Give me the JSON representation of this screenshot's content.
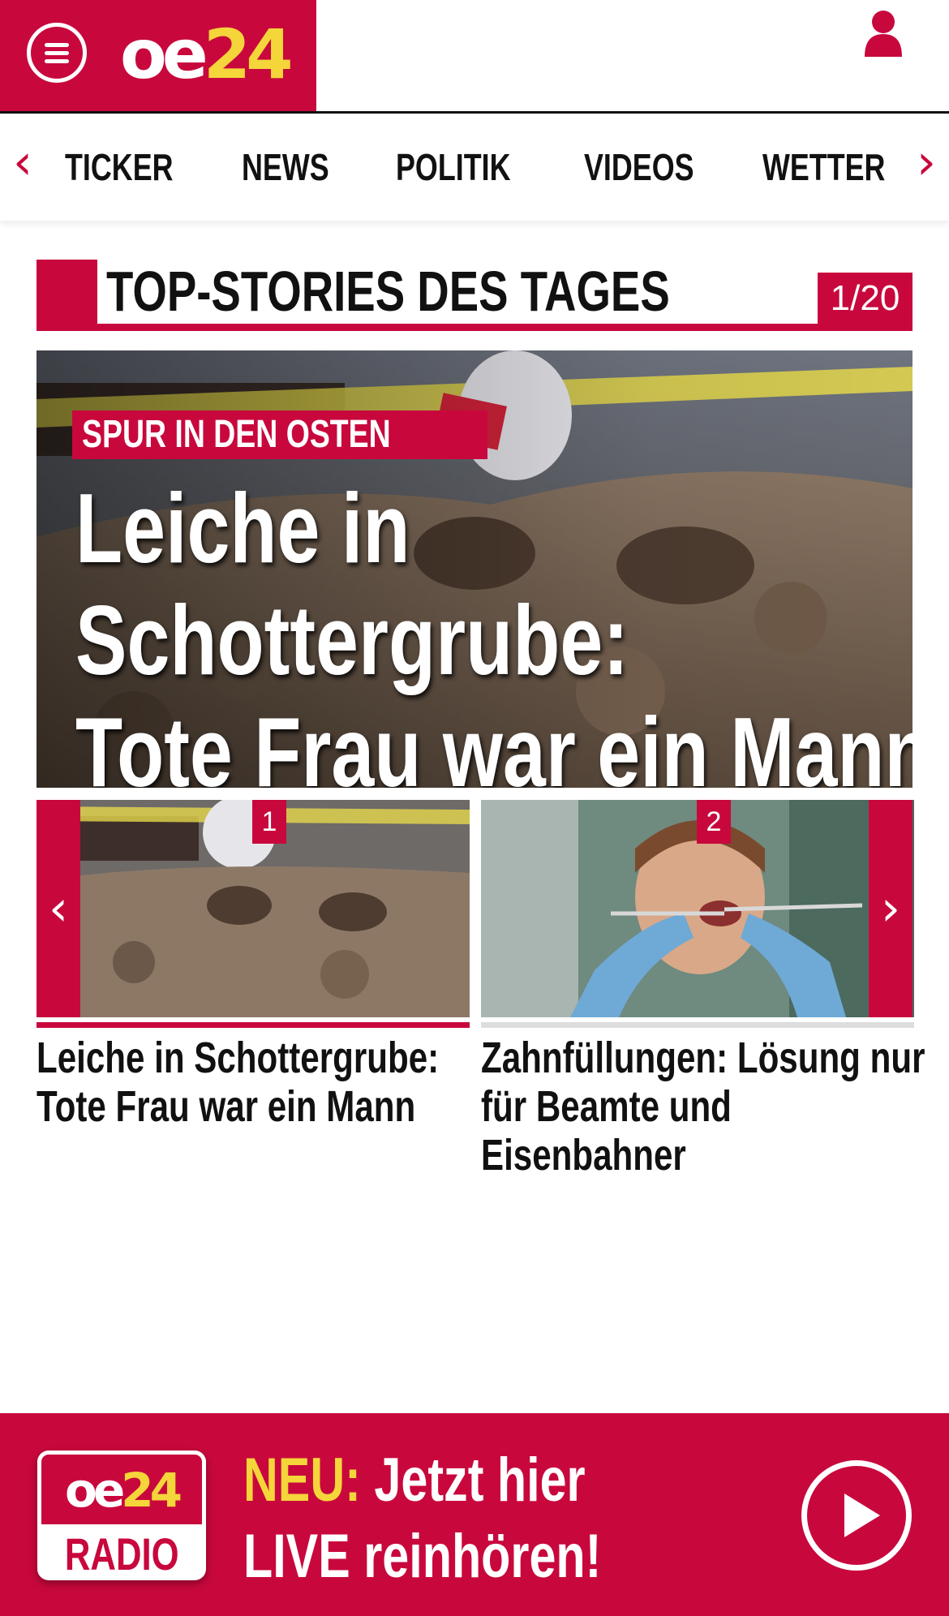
{
  "header": {
    "logo": {
      "oe": "oe",
      "num": "24"
    },
    "menu_icon": "hamburger-menu-icon",
    "user_icon": "user-icon"
  },
  "nav": {
    "prev_glyph": "‹",
    "next_glyph": "›",
    "items": [
      "TICKER",
      "NEWS",
      "POLITIK",
      "VIDEOS",
      "WETTER"
    ]
  },
  "section": {
    "title": "TOP-STORIES DES TAGES",
    "counter": "1/20"
  },
  "hero": {
    "kicker": "SPUR IN DEN OSTEN",
    "title_lines": [
      "Leiche in",
      "Schottergrube:",
      "Tote Frau war ein Mann"
    ]
  },
  "cards": [
    {
      "badge": "1",
      "title_lines": [
        "Leiche in Schottergrube:",
        "Tote Frau war ein Mann"
      ],
      "active": true
    },
    {
      "badge": "2",
      "title_lines": [
        "Zahnfüllungen: Lösung nur",
        "für Beamte und",
        "Eisenbahner"
      ],
      "active": false
    }
  ],
  "slider": {
    "prev_glyph": "‹",
    "next_glyph": "›"
  },
  "radio": {
    "logo": {
      "oe": "oe",
      "num": "24",
      "label": "RADIO"
    },
    "neu": "NEU:",
    "line1_rest": " Jetzt hier",
    "line2": "LIVE reinhören!",
    "play_icon": "play-icon"
  },
  "colors": {
    "brand_red": "#c8083d",
    "brand_yellow": "#f4d53a",
    "text_dark": "#111111",
    "rule_inactive": "#dddddd"
  }
}
